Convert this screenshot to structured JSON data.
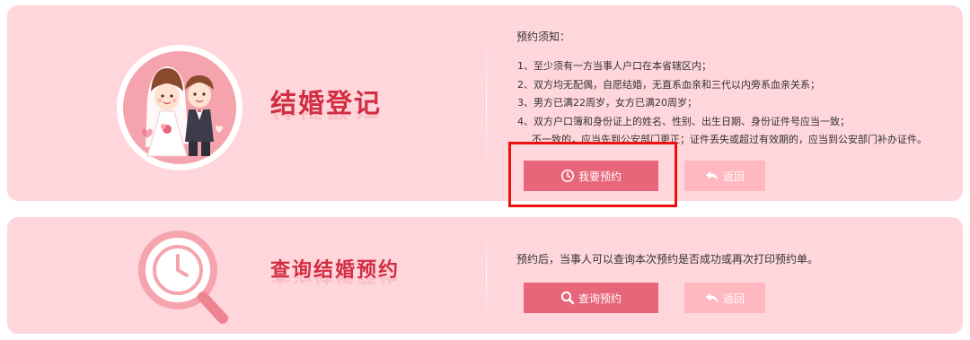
{
  "register": {
    "title": "结婚登记",
    "notice_heading": "预约须知：",
    "notice_items": [
      "1、至少须有一方当事人户口在本省辖区内；",
      "2、双方均无配偶，自愿结婚，无直系血亲和三代以内旁系血亲关系；",
      "3、男方已满22周岁，女方已满20周岁；",
      "4、双方户口簿和身份证上的姓名、性别、出生日期、身份证件号应当一致；",
      "不一致的，应当先到公安部门更正；证件丢失或超过有效期的，应当到公安部门补办证件。"
    ],
    "book_button": {
      "label": "我要预约",
      "icon": "clock-icon"
    },
    "back_button": {
      "label": "返回",
      "icon": "return-arrow-icon"
    }
  },
  "query": {
    "title": "查询结婚预约",
    "description": "预约后，当事人可以查询本次预约是否成功或再次打印预约单。",
    "query_button": {
      "label": "查询预约",
      "icon": "search-icon"
    },
    "back_button": {
      "label": "返回",
      "icon": "return-arrow-icon"
    }
  },
  "colors": {
    "card_background": "#ffd6db",
    "title": "#d22d42",
    "primary_button": "#e7667a",
    "secondary_button": "#ffb7c0",
    "highlight_border": "#ee1111"
  }
}
